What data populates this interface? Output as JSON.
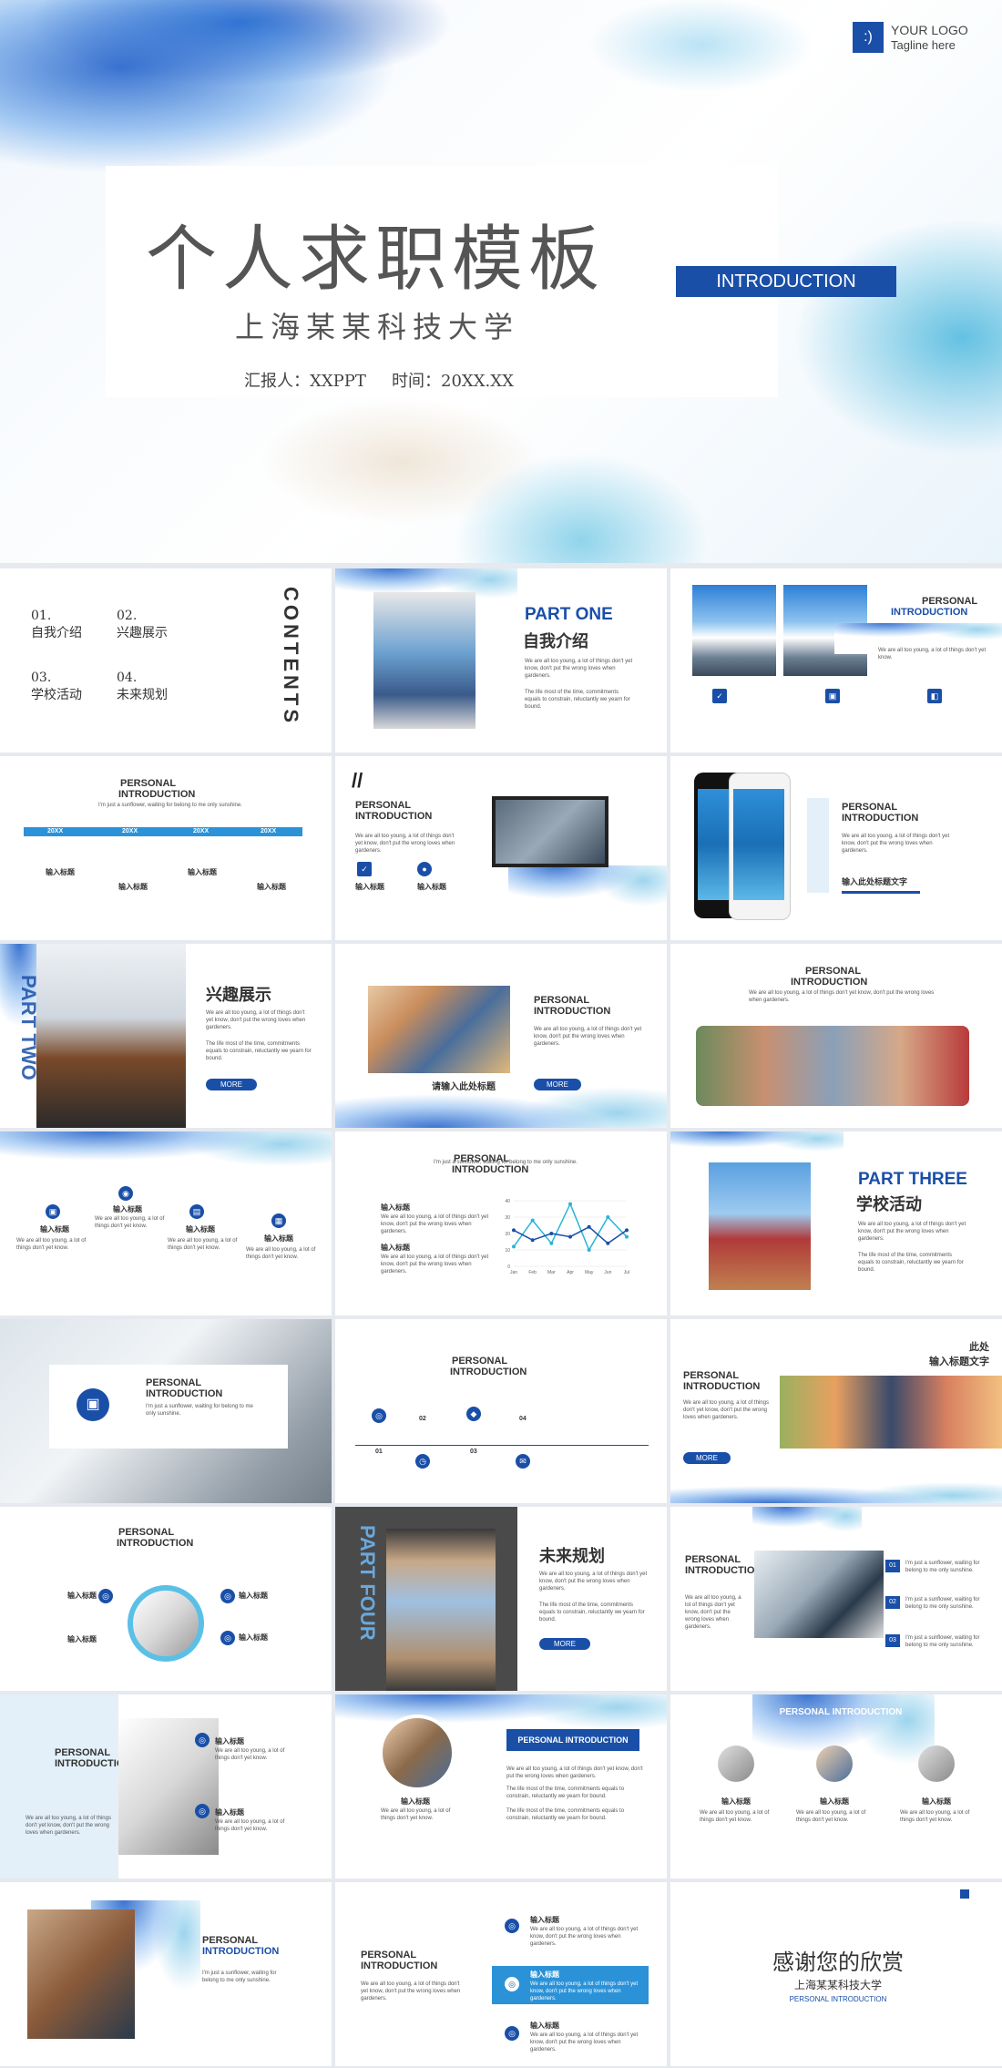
{
  "cover": {
    "title": "个人求职模板",
    "university": "上海某某科技大学",
    "reporter": "汇报人：XXPPT",
    "time": "时间：20XX.XX",
    "intro_label": "INTRODUCTION",
    "logo_text": "YOUR LOGO",
    "logo_tagline": "Tagline here"
  },
  "contents": {
    "label": "CONTENTS",
    "items": [
      {
        "num": "01.",
        "title": "自我介绍"
      },
      {
        "num": "02.",
        "title": "兴趣展示"
      },
      {
        "num": "03.",
        "title": "学校活动"
      },
      {
        "num": "04.",
        "title": "未来规划"
      }
    ]
  },
  "part_one": {
    "label": "PART ONE",
    "title": "自我介绍",
    "text1": "We are all too young, a lot of things don't yet know, don't put the wrong loves when gardeners.",
    "text2": "The life most of the time, commitments equals to constrain, reluctantly we yearn for bound."
  },
  "personal": {
    "title1": "PERSONAL",
    "title2": "INTRODUCTION",
    "sunflower": "I'm just a sunflower, waiting for belong to me only sunshine.",
    "short": "We are all too young, a lot of things don't yet know."
  },
  "timeline": {
    "years": [
      "20XX",
      "20XX",
      "20XX",
      "20XX"
    ],
    "heading": "输入标题"
  },
  "hobby": {
    "part": "PART TWO",
    "title": "兴趣展示",
    "more": "MORE"
  },
  "photo_caption": "请输入此处标题",
  "input_title": "输入此处标题文字",
  "chart": {
    "months": [
      "Jan",
      "Feb",
      "Mar",
      "Apr",
      "May",
      "Jun",
      "Jul"
    ],
    "series_a": [
      12,
      28,
      14,
      38,
      10,
      30,
      18
    ],
    "series_b": [
      22,
      16,
      20,
      18,
      24,
      14,
      22
    ],
    "ticks": [
      "40",
      "30",
      "20",
      "10",
      "0"
    ]
  },
  "part_three": {
    "label": "PART THREE",
    "title": "学校活动"
  },
  "steps": [
    "01",
    "02",
    "03",
    "04"
  ],
  "output_title": "此处\n输入标题文字",
  "part_four": {
    "label": "PART FOUR",
    "title": "未来规划",
    "more": "MORE"
  },
  "numbers": [
    "01",
    "02",
    "03"
  ],
  "personal_intro_bar": "PERSONAL INTRODUCTION",
  "thanks": {
    "title": "感谢您的欣赏",
    "university": "上海某某科技大学",
    "sub": "PERSONAL INTRODUCTION"
  }
}
